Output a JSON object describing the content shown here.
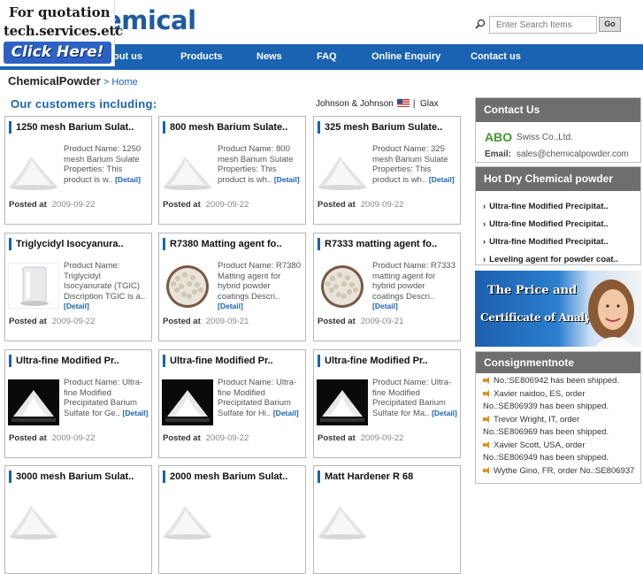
{
  "promo": {
    "line1": "For quotation",
    "line2": "tech.services.etc",
    "button": "Click Here!"
  },
  "logo": {
    "text": "emical"
  },
  "search": {
    "placeholder": "Enter Search Items",
    "go": "Go"
  },
  "nav": [
    "out us",
    "Products",
    "News",
    "FAQ",
    "Online Enquiry",
    "Contact us"
  ],
  "breadcrumb": {
    "site": "ChemicalPowder",
    "sep": " > ",
    "home": "Home"
  },
  "customers": {
    "title": "Our customers including:",
    "partner1": "Johnson & Johnson",
    "separator": "|",
    "partner2": "Glax"
  },
  "products": [
    {
      "title": "1250 mesh Barium Sulat..",
      "desc": "Product Name: 1250 mesh Barium Sulate Properties: This product is w..",
      "detail": "[Detail]",
      "posted_label": "Posted at",
      "date": "2009-09-22"
    },
    {
      "title": "800 mesh Barium Sulate..",
      "desc": "Product Name: 800 mesh Barium Sulate Properties: This product is wh..",
      "detail": "[Detail]",
      "posted_label": "Posted at",
      "date": "2009-09-22"
    },
    {
      "title": "325 mesh Barium Sulate..",
      "desc": "Product Name: 325 mesh Barium Sulate Properties: This product is wh..",
      "detail": "[Detail]",
      "posted_label": "Posted at",
      "date": "2009-09-22"
    },
    {
      "title": "Triglycidyl Isocyanura..",
      "desc": "Product Name: Triglycidyl Isocyanurate (TGIC) Discription TGIC is a..",
      "detail": "[Detail]",
      "posted_label": "Posted at",
      "date": "2009-09-22"
    },
    {
      "title": "R7380 Matting agent fo..",
      "desc": "Product Name: R7380 Matting agent for hybrid powder coatings Descri..",
      "detail": "[Detail]",
      "posted_label": "Posted at",
      "date": "2009-09-21"
    },
    {
      "title": "R7333 matting agent fo..",
      "desc": "Product Name: R7333 matting agent for hybrid powder coatings Descri..",
      "detail": "[Detail]",
      "posted_label": "Posted at",
      "date": "2009-09-21"
    },
    {
      "title": "Ultra-fine Modified Pr..",
      "desc": "Product Name: Ultra-fine Modified Precipitated Barium Sulfate for Ge..",
      "detail": "[Detail]",
      "posted_label": "Posted at",
      "date": "2009-09-22"
    },
    {
      "title": "Ultra-fine Modified Pr..",
      "desc": "Product Name: Ultra-fine Modified Precipitated Barium Sulfate for Hi..",
      "detail": "[Detail]",
      "posted_label": "Posted at",
      "date": "2009-09-22"
    },
    {
      "title": "Ultra-fine Modified Pr..",
      "desc": "Product Name: Ultra-fine Modified Precipitated Barium Sulfate for Ma..",
      "detail": "[Detail]",
      "posted_label": "Posted at",
      "date": "2009-09-22"
    },
    {
      "title": "3000 mesh Barium Sulat..",
      "desc": "",
      "detail": "",
      "posted_label": "",
      "date": ""
    },
    {
      "title": "2000 mesh Barium Sulat..",
      "desc": "",
      "detail": "",
      "posted_label": "",
      "date": ""
    },
    {
      "title": "Matt Hardener R 68",
      "desc": "",
      "detail": "",
      "posted_label": "",
      "date": ""
    }
  ],
  "contact": {
    "title": "Contact Us",
    "company_bold": "ABO",
    "company_rest": "Swiss Co.,Ltd.",
    "email_label": "Email:",
    "email": "sales@chemicalpowder.com"
  },
  "hot": {
    "title": "Hot Dry Chemical powder",
    "items": [
      "Ultra-fine Modified Precipitat..",
      "Ultra-fine Modified Precipitat..",
      "Ultra-fine Modified Precipitat..",
      "Leveling agent for powder coat.."
    ]
  },
  "banner": {
    "line1": "The Price and",
    "line2": "Certificate of Analysis"
  },
  "consign": {
    "title": "Consignmentnote",
    "lines": [
      "No.:SE806942 has been shipped.",
      "Xavier naidoo, ES, order",
      "No.:SE806939 has been shipped.",
      "Trevor Wright, IT, order",
      "No.:SE806969 has been shipped.",
      "Xavier Scott, USA, order",
      "No.:SE806949 has been shipped.",
      "Wythe Gino, FR, order No.:SE806937"
    ]
  }
}
